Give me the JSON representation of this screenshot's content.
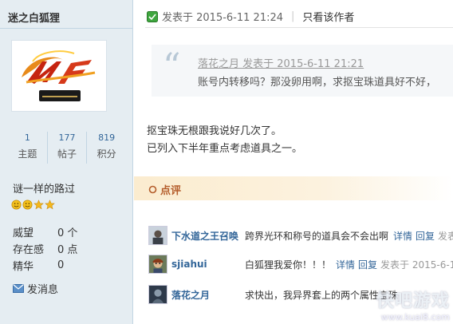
{
  "sidebar": {
    "username": "迷之白狐狸",
    "stats": [
      {
        "num": "1",
        "label": "主题"
      },
      {
        "num": "177",
        "label": "帖子"
      },
      {
        "num": "819",
        "label": "积分"
      }
    ],
    "motto": "谜一样的路过",
    "info": [
      {
        "key": "威望",
        "value": "0 个"
      },
      {
        "key": "存在感",
        "value": "0 点"
      },
      {
        "key": "精华",
        "value": "0"
      }
    ],
    "message_link": "发消息"
  },
  "post": {
    "posted_at": "发表于 2015-6-11 21:24",
    "only_author": "只看该作者",
    "quote": {
      "meta": "落花之月 发表于 2015-6-11 21:21",
      "text": "账号内转移吗？那没卵用啊，求抠宝珠道具好不好，"
    },
    "body_lines": [
      "抠宝珠无根跟我说好几次了。",
      "已列入下半年重点考虑道具之一。"
    ],
    "review_label": "点评"
  },
  "comments": [
    {
      "name": "下水道之王召唤",
      "text": "跨界光环和称号的道具会不会出啊",
      "detail": "详情",
      "reply": "回复",
      "time": "发表于"
    },
    {
      "name": "sjiahui",
      "text": "白狐狸我爱你！！！",
      "detail": "详情",
      "reply": "回复",
      "time": "发表于 2015-6-1"
    },
    {
      "name": "落花之月",
      "text": "求快出，我异界套上的两个属性宝珠",
      "detail": "",
      "reply": "",
      "time": ""
    }
  ],
  "watermark": {
    "main": "快吧游戏",
    "sub": "www.kuai8.com"
  },
  "colors": {
    "sidebar_bg": "#e5edf2",
    "link": "#336699",
    "review": "#b45c2a"
  }
}
